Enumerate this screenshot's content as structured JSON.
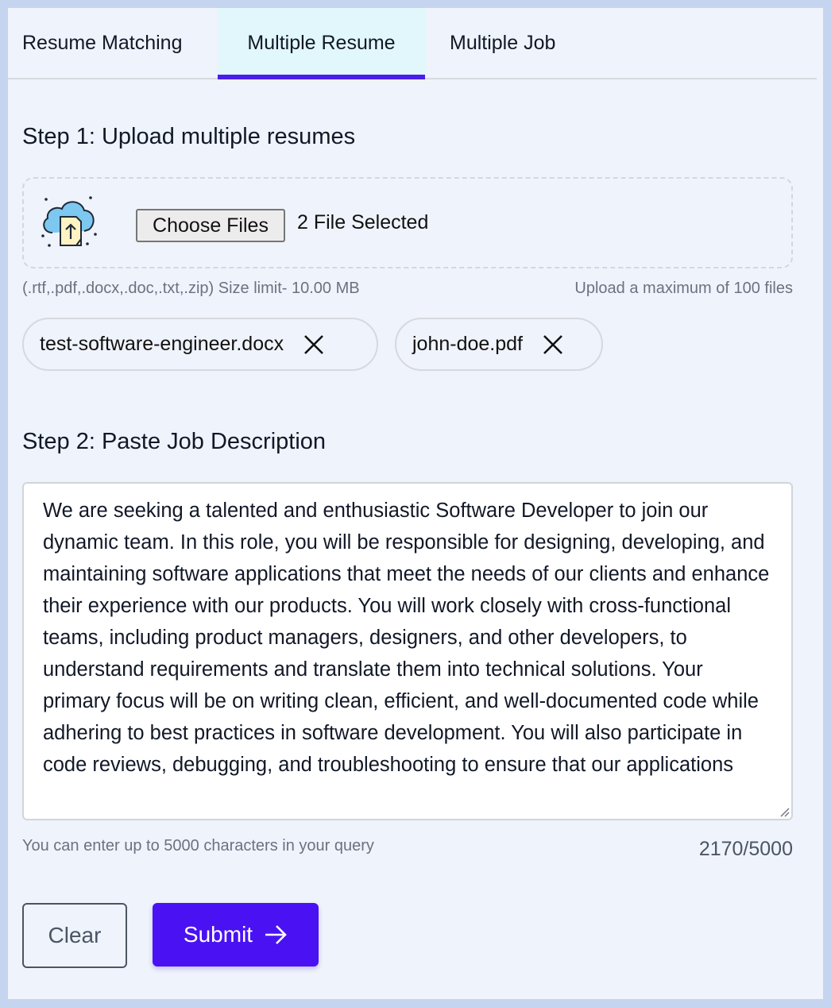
{
  "tabs": [
    {
      "label": "Resume Matching",
      "active": false
    },
    {
      "label": "Multiple Resume",
      "active": true
    },
    {
      "label": "Multiple Job",
      "active": false
    }
  ],
  "step1": {
    "title": "Step 1: Upload multiple resumes",
    "choose_label": "Choose Files",
    "file_status": "2 File Selected",
    "formats_hint": "(.rtf,.pdf,.docx,.doc,.txt,.zip) Size limit- 10.00 MB",
    "max_hint": "Upload a maximum of 100 files",
    "files": [
      "test-software-engineer.docx",
      "john-doe.pdf"
    ]
  },
  "step2": {
    "title": "Step 2: Paste Job Description",
    "job_description": "We are seeking a talented and enthusiastic Software Developer to join our dynamic team. In this role, you will be responsible for designing, developing, and maintaining software applications that meet the needs of our clients and enhance their experience with our products. You will work closely with cross-functional teams, including product managers, designers, and other developers, to understand requirements and translate them into technical solutions. Your primary focus will be on writing clean, efficient, and well-documented code while adhering to best practices in software development. You will also participate in code reviews, debugging, and troubleshooting to ensure that our applications",
    "char_hint": "You can enter up to 5000 characters in your query",
    "char_count": "2170/5000"
  },
  "actions": {
    "clear_label": "Clear",
    "submit_label": "Submit"
  },
  "colors": {
    "accent": "#4a12f2",
    "tab_active_bg": "#e2f7fb",
    "page_bg": "#eff3fb"
  }
}
